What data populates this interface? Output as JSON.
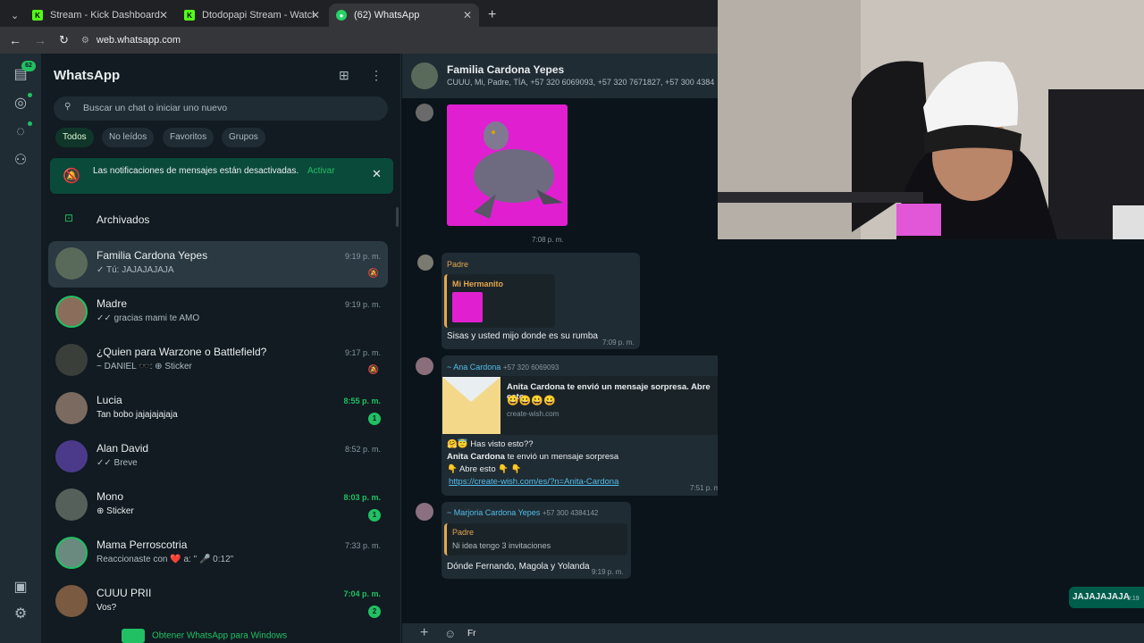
{
  "browser": {
    "tabs": [
      {
        "label": "Stream - Kick Dashboard",
        "icon": "kick-icon"
      },
      {
        "label": "Dtodopapi Stream - Watch Live",
        "icon": "kick-icon"
      },
      {
        "label": "(62) WhatsApp",
        "icon": "whatsapp-icon"
      }
    ],
    "url": "web.whatsapp.com"
  },
  "rail": {
    "badge": "62"
  },
  "sidebar": {
    "title": "WhatsApp",
    "search_placeholder": "Buscar un chat o iniciar uno nuevo",
    "filters": [
      "Todos",
      "No leídos",
      "Favoritos",
      "Grupos"
    ],
    "notice": {
      "text": "Las notificaciones de mensajes están desactivadas.",
      "action": "Activar"
    },
    "archived": "Archivados",
    "chats": [
      {
        "name": "Familia Cardona Yepes",
        "last": "✓ Tú: JAJAJAJAJA",
        "time": "9:19 p. m.",
        "badge": "",
        "muted": true
      },
      {
        "name": "Madre",
        "last": "✓✓ gracias mami te  AMO",
        "time": "9:19 p. m.",
        "badge": "",
        "muted": false
      },
      {
        "name": "¿Quien para Warzone o Battlefield?",
        "last": "~ DANIEL 🕶️: ⊕ Sticker",
        "time": "9:17 p. m.",
        "badge": "",
        "muted": true
      },
      {
        "name": "Lucia",
        "last": "Tan bobo jajajajajaja",
        "time": "8:55 p. m.",
        "badge": "1",
        "muted": false
      },
      {
        "name": "Alan David",
        "last": "✓✓ Breve",
        "time": "8:52 p. m.",
        "badge": "",
        "muted": false
      },
      {
        "name": "Mono",
        "last": "⊕ Sticker",
        "time": "8:03 p. m.",
        "badge": "1",
        "muted": false
      },
      {
        "name": "Mama Perroscotria",
        "last": "Reaccionaste con ❤️ a: \" 🎤 0:12\"",
        "time": "7:33 p. m.",
        "badge": "",
        "muted": false
      },
      {
        "name": "CUUU PRII",
        "last": "Vos?",
        "time": "7:04 p. m.",
        "badge": "2",
        "muted": false
      }
    ],
    "footer": "Obtener WhatsApp para Windows"
  },
  "conversation": {
    "name": "Familia Cardona Yepes",
    "members": "CUUU, Mi, Padre, TÍA, +57 320 6069093, +57 320 7671827, +57 300 4384142",
    "messages": {
      "m1_time": "7:08 p. m.",
      "m2_sender": "Padre",
      "m2_quote_sender": "Mi Hermanito",
      "m2_text": "Sisas y usted mijo donde es su rumba",
      "m2_time": "7:09 p. m.",
      "m3_sender": "~ Ana Cardona",
      "m3_phone": "+57 320 6069093",
      "m3_link_title": "Anita Cardona te envió un mensaje sorpresa. Abre esto",
      "m3_link_emojis": "😀😀😀😀",
      "m3_link_domain": "create-wish.com",
      "m3_line1": "🤗😇 Has visto esto??",
      "m3_line2_bold": "Anita Cardona",
      "m3_line2_rest": " te envió un mensaje sorpresa",
      "m3_line3": "👇 Abre esto 👇 👇",
      "m3_url": "https://create-wish.com/es/?n=Anita-Cardona",
      "m3_time": "7:51 p. m.",
      "m4_sender": "~ Marjoria Cardona Yepes",
      "m4_phone": "+57 300 4384142",
      "m4_quote_sender": "Padre",
      "m4_quote_text": "Ni idea tengo 3 invitaciones",
      "m4_text": "Dónde Fernando, Magola y Yolanda",
      "m4_time": "9:19 p. m.",
      "out_text": "JAJAJAJAJA",
      "out_time": "9:19"
    },
    "input_value": "Fr"
  },
  "colors": {
    "accent": "#21c063",
    "panel": "#111b21",
    "bubble": "#202c33",
    "outgoing": "#005c4b"
  }
}
